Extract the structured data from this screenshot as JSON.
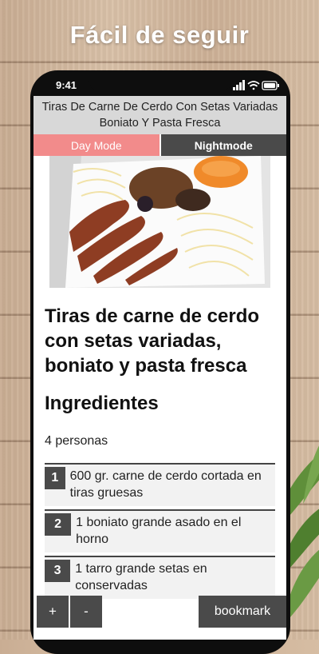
{
  "headline": "Fácil de seguir",
  "status": {
    "time": "9:41"
  },
  "title_bar": "Tiras De Carne De Cerdo Con Setas Variadas Boniato Y Pasta Fresca",
  "modes": {
    "day": "Day Mode",
    "night": "Nightmode"
  },
  "recipe": {
    "title": "Tiras de carne de cerdo con setas variadas, boniato y pasta fresca",
    "ingredients_heading": "Ingredientes",
    "servings": "4 personas",
    "ingredients": [
      {
        "num": "1",
        "text": "600 gr. carne de cerdo cortada en tiras gruesas"
      },
      {
        "num": "2",
        "text": "1 boniato grande asado en el horno"
      },
      {
        "num": "3",
        "text": "1 tarro grande setas en conservadas"
      }
    ]
  },
  "toolbar": {
    "plus": "+",
    "minus": "-",
    "bookmark": "bookmark"
  },
  "icons": [
    "signal-icon",
    "wifi-icon",
    "battery-icon",
    "plus-icon",
    "minus-icon"
  ],
  "colors": {
    "day_mode": "#f28b8b",
    "night_mode": "#4a4a4a",
    "title_bar": "#d8d8d8"
  }
}
